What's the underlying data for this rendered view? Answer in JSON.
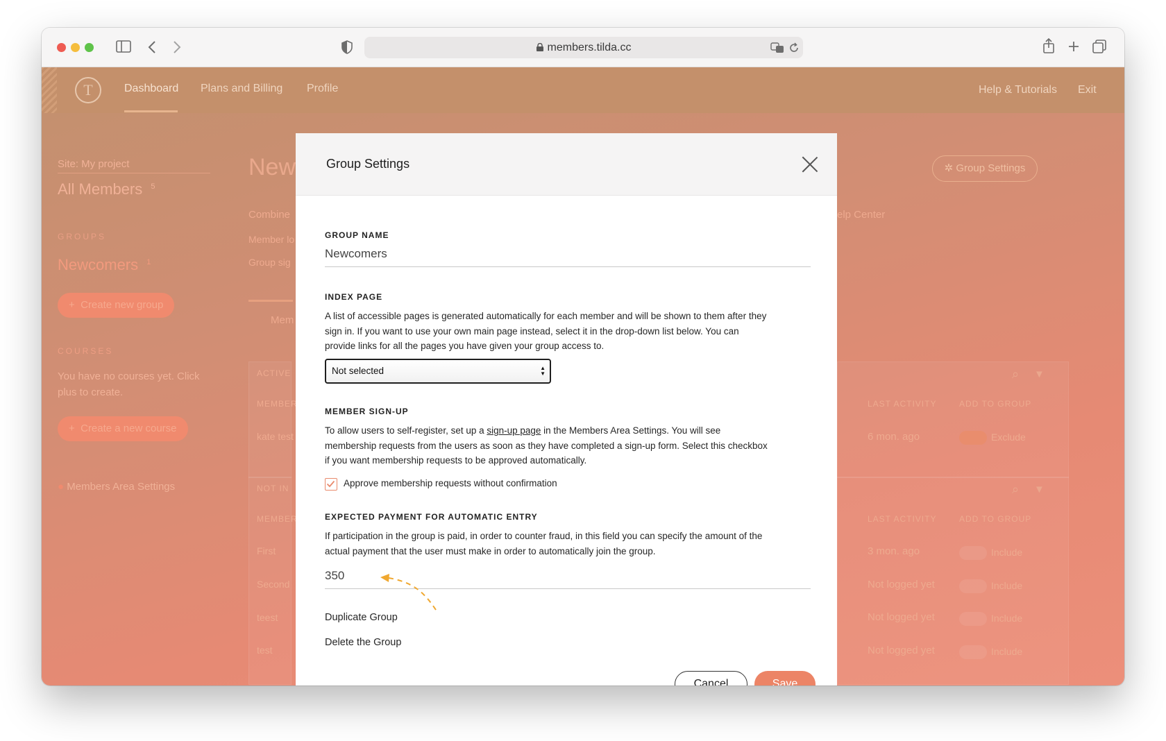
{
  "browser": {
    "url": "members.tilda.cc"
  },
  "topnav": {
    "items": [
      "Dashboard",
      "Plans and Billing",
      "Profile"
    ],
    "right_items": [
      "Help & Tutorials",
      "Exit"
    ]
  },
  "sidebar": {
    "site": "Site: My project",
    "all_members": "All Members",
    "all_members_count": "5",
    "groups_heading": "GROUPS",
    "group_name": "Newcomers",
    "group_count": "1",
    "create_group": "Create new group",
    "courses_heading": "COURSES",
    "courses_empty": "You have no courses yet. Click plus to create.",
    "create_course": "Create a new course",
    "members_area_settings": "Members Area Settings"
  },
  "background": {
    "page_title": "New",
    "group_settings_button": "Group Settings",
    "combine_text": "Combine",
    "member_text": "Member lo",
    "group_text": "Group sig",
    "help_center": "elp Center",
    "tab": "Mem",
    "active_heading": "ACTIVE",
    "not_in_heading": "NOT IN",
    "member_col": "MEMBER",
    "last_activity_col": "LAST ACTIVITY",
    "add_to_group_col": "ADD TO GROUP",
    "active_rows": [
      {
        "name": "kate test",
        "last_activity": "6 mon. ago",
        "action": "Exclude"
      }
    ],
    "not_in_rows": [
      {
        "name": "First",
        "last_activity": "3 mon. ago",
        "action": "Include"
      },
      {
        "name": "Second",
        "last_activity": "Not logged yet",
        "action": "Include"
      },
      {
        "name": "teest",
        "last_activity": "Not logged yet",
        "action": "Include"
      },
      {
        "name": "test",
        "last_activity": "Not logged yet",
        "action": "Include"
      }
    ]
  },
  "modal": {
    "title": "Group Settings",
    "group_name_label": "GROUP NAME",
    "group_name_value": "Newcomers",
    "index_page_label": "INDEX PAGE",
    "index_page_text": "A list of accessible pages is generated automatically for each member and will be shown to them after they sign in. If you want to use your own main page instead, select it in the drop-down list below. You can provide links for all the pages you have given your group access to.",
    "index_page_select": "Not selected",
    "signup_label": "MEMBER SIGN-UP",
    "signup_text_before": "To allow users to self-register, set up a ",
    "signup_link": "sign-up page",
    "signup_text_after": " in the Members Area Settings. You will see membership requests from the users as soon as they have completed a sign-up form. Select this checkbox if you want membership requests to be approved automatically.",
    "approve_checkbox_label": "Approve membership requests without confirmation",
    "approve_checked": true,
    "payment_label": "EXPECTED PAYMENT FOR AUTOMATIC ENTRY",
    "payment_text": "If participation in the group is paid, in order to counter fraud, in this field you can specify the amount of the actual payment that the user must make in order to automatically join the group.",
    "payment_value": "350",
    "duplicate_group": "Duplicate Group",
    "delete_group": "Delete the Group",
    "cancel": "Cancel",
    "save": "Save"
  },
  "colors": {
    "accent": "#ec8466",
    "topnav": "#c4906b",
    "annotation": "#f0a830"
  }
}
